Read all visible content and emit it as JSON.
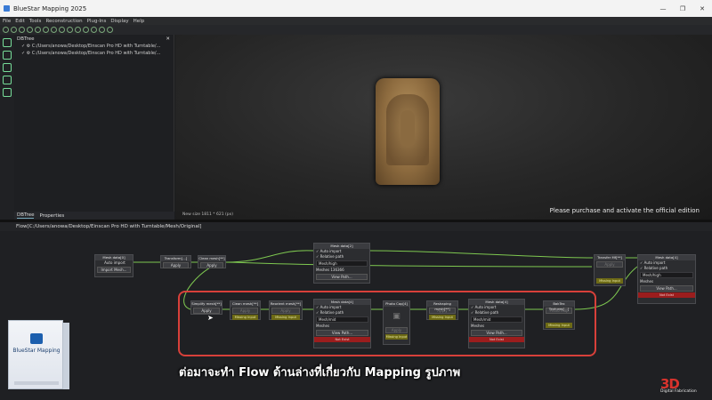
{
  "window": {
    "title": "BlueStar Mapping 2025",
    "controls": [
      "—",
      "❐",
      "✕"
    ]
  },
  "menu": [
    "File",
    "Edit",
    "Tools",
    "Reconstruction",
    "Plug-Ins",
    "Display",
    "Help"
  ],
  "dbtree": {
    "title": "DBTree",
    "items": [
      "C:/Users/anowa/Desktop/Einscan Pro HD with Turntable/...",
      "C:/Users/anowa/Desktop/Einscan Pro HD with Turntable/..."
    ],
    "tabs": [
      "DBTree",
      "Properties"
    ]
  },
  "viewport": {
    "status": "New size 1811 * 621 (px)",
    "notice": "Please purchase and activate the official edition"
  },
  "flow": {
    "title": "Flow[C:/Users/anowa/Desktop/Einscan Pro HD with Turntable/Mesh/Original]",
    "nodes": {
      "mesh_import": {
        "title": "Mesh data[0]",
        "sub": "Auto import",
        "button": "Import Mesh..."
      },
      "transform": {
        "title": "Transform[...]",
        "button": "Apply"
      },
      "clean_mesh": {
        "title": "Clean mesh[**]",
        "button": "Apply"
      },
      "top_mesh_data": {
        "title": "Mesh data[2]",
        "chk1": "Auto import",
        "chk2": "Relative path",
        "field": "Mesh/high",
        "meshes": "Meshes 136366",
        "button": "View Path..."
      },
      "simplify": {
        "title": "Simplify mesh[**]",
        "button": "Apply"
      },
      "clean2": {
        "title": "Clean mesh[**]",
        "button": "Apply",
        "warn": "Missing Input"
      },
      "reorient": {
        "title": "Reorient mesh[**]",
        "button": "Apply",
        "warn": "Missing Input"
      },
      "mid_mesh_data": {
        "title": "Mesh data[4]",
        "chk1": "Auto import",
        "chk2": "Relative path",
        "field": "Mesh/mid",
        "meshes": "Meshes",
        "button": "View Path...",
        "err": "Not Exist"
      },
      "photo_cap": {
        "title": "Photo Cap[4]",
        "button": "Apply",
        "warn": "Missing Input"
      },
      "reshape": {
        "title": "Reshaping mesh[**]",
        "button": "Apply",
        "warn": "Missing Input"
      },
      "right_mesh_data": {
        "title": "Mesh data[4]",
        "chk1": "Auto import",
        "chk2": "Relative path",
        "field": "Mesh/mid",
        "meshes": "Meshes",
        "button": "View Path...",
        "err": "Not Exist"
      },
      "bake": {
        "title": "BakTex Textures[...]",
        "button": "Photo Map",
        "warn": "Missing Input"
      },
      "transfer": {
        "title": "Transfer Mf[**]",
        "button": "Apply",
        "warn": "Missing Input"
      },
      "far_mesh_data": {
        "title": "Mesh data[4]",
        "chk1": "Auto import",
        "chk2": "Relative path",
        "field": "Mesh/high",
        "meshes": "Meshes",
        "button": "View Path...",
        "err": "Not Exist"
      }
    }
  },
  "product_box": {
    "name": "BlueStar Mapping"
  },
  "subtitle": "ต่อมาจะทำ Flow ด้านล่างที่เกี่ยวกับ Mapping รูปภาพ",
  "brand": {
    "mark": "3D",
    "sub": "Digital Fabrication"
  }
}
